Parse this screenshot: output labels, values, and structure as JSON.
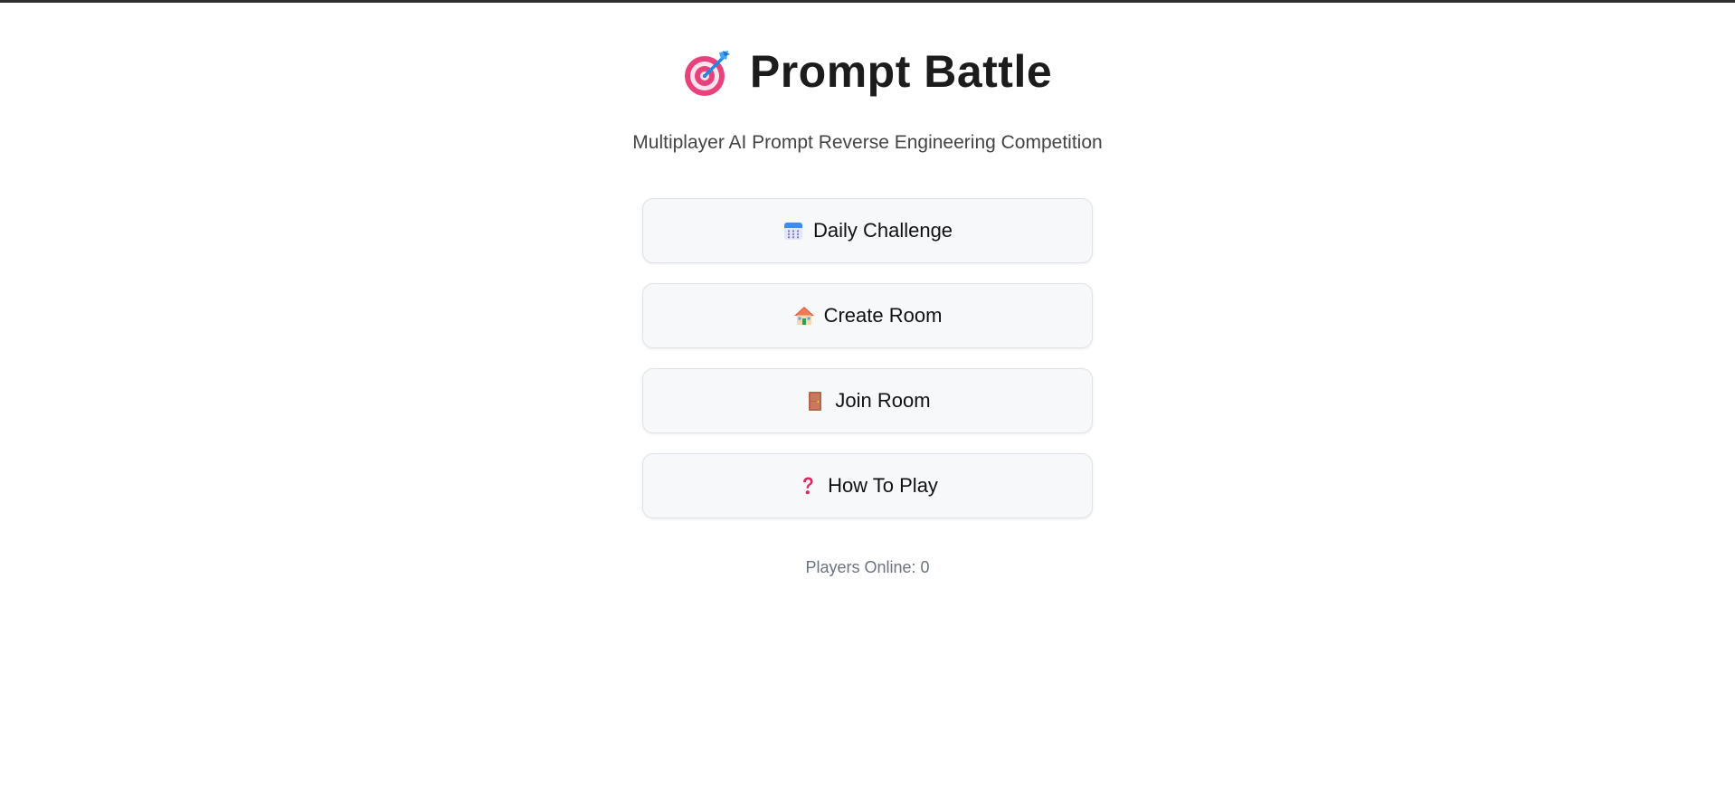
{
  "header": {
    "title": "Prompt Battle",
    "title_icon": "target-dart-icon",
    "subtitle": "Multiplayer AI Prompt Reverse Engineering Competition"
  },
  "menu": {
    "items": [
      {
        "label": "Daily Challenge",
        "icon": "calendar-icon"
      },
      {
        "label": "Create Room",
        "icon": "house-icon"
      },
      {
        "label": "Join Room",
        "icon": "door-icon"
      },
      {
        "label": "How To Play",
        "icon": "question-mark-icon"
      }
    ]
  },
  "status": {
    "players_online": "Players Online: 0"
  },
  "colors": {
    "button_bg": "#f7f8fa",
    "button_border": "#dfe2e7",
    "title_text": "#1c1c1c",
    "muted_text": "#6b7280"
  }
}
